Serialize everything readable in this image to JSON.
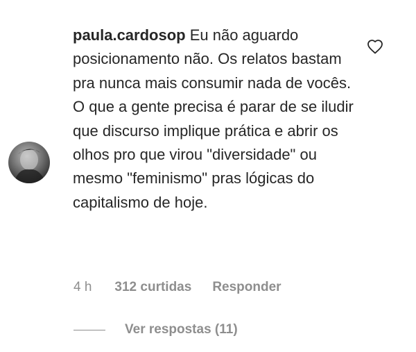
{
  "comment": {
    "username": "paula.cardosop",
    "text": "Eu não aguardo posicionamento não. Os relatos bastam pra nunca mais consumir nada de vocês. O que a gente precisa é parar de se iludir que discurso implique prática e abrir os olhos pro que virou \"diversidade\" ou mesmo \"feminismo\" pras lógicas do capitalismo de hoje.",
    "avatar_icon": "user-avatar-photo",
    "like_icon": "heart-outline-icon"
  },
  "meta": {
    "time": "4 h",
    "likes": "312 curtidas",
    "reply_label": "Responder"
  },
  "replies": {
    "label": "Ver respostas (11)"
  },
  "colors": {
    "text": "#262626",
    "secondary": "#8e8e8e"
  }
}
